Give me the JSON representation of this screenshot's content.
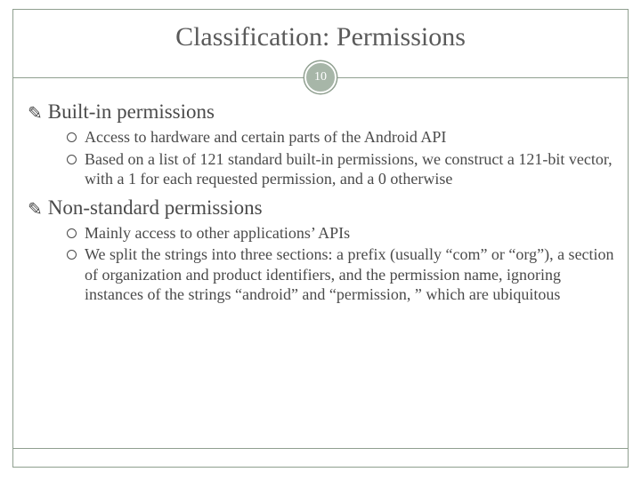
{
  "slide": {
    "title": "Classification: Permissions",
    "page_number": "10",
    "sections": [
      {
        "heading": "Built-in permissions",
        "items": [
          "Access to hardware and certain parts of the Android API",
          "Based on a list of 121 standard built-in permissions, we construct a 121-bit vector, with a 1 for each requested permission, and a 0 otherwise"
        ]
      },
      {
        "heading": "Non-standard permissions",
        "items": [
          "Mainly access to other applications’ APIs",
          "We split the strings into three sections: a prefix (usually “com” or “org”), a section of organization and product identifiers, and the permission name, ignoring instances of the strings “android” and “permission, ” which are ubiquitous"
        ]
      }
    ]
  }
}
